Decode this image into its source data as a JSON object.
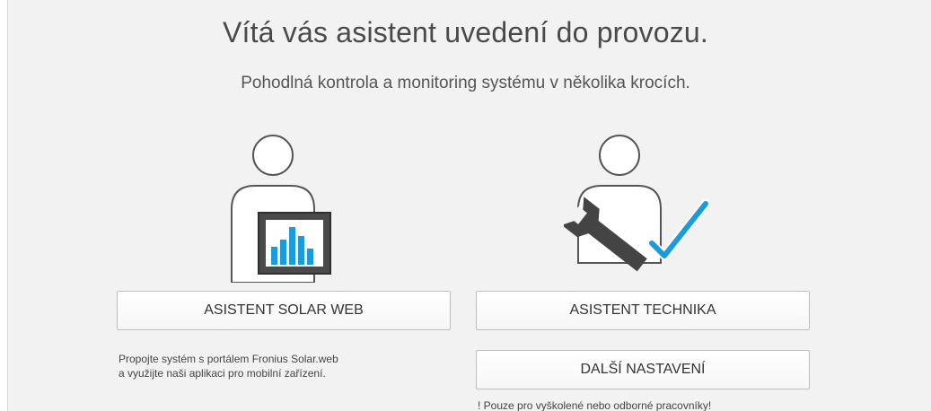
{
  "header": {
    "title": "Vítá vás asistent uvedení do provozu.",
    "subtitle": "Pohodlná kontrola a monitoring systému v několika krocích."
  },
  "options": {
    "solar_web": {
      "button_label": "ASISTENT SOLAR WEB",
      "description_line1": "Propojte systém s portálem Fronius Solar.web",
      "description_line2": "a využijte naši aplikaci pro mobilní zařízení.",
      "icon": "user-with-chart-monitor-icon"
    },
    "technician": {
      "button_label": "ASISTENT TECHNIKA",
      "icon": "user-with-wrench-and-checkmark-icon"
    },
    "more_settings": {
      "button_label": "DALŠÍ NASTAVENÍ",
      "note": "! Pouze pro vyškolené nebo odborné pracovníky!"
    }
  },
  "colors": {
    "accent_blue": "#1a9bdc",
    "icon_gray": "#444444",
    "background": "#f2f2f2"
  }
}
